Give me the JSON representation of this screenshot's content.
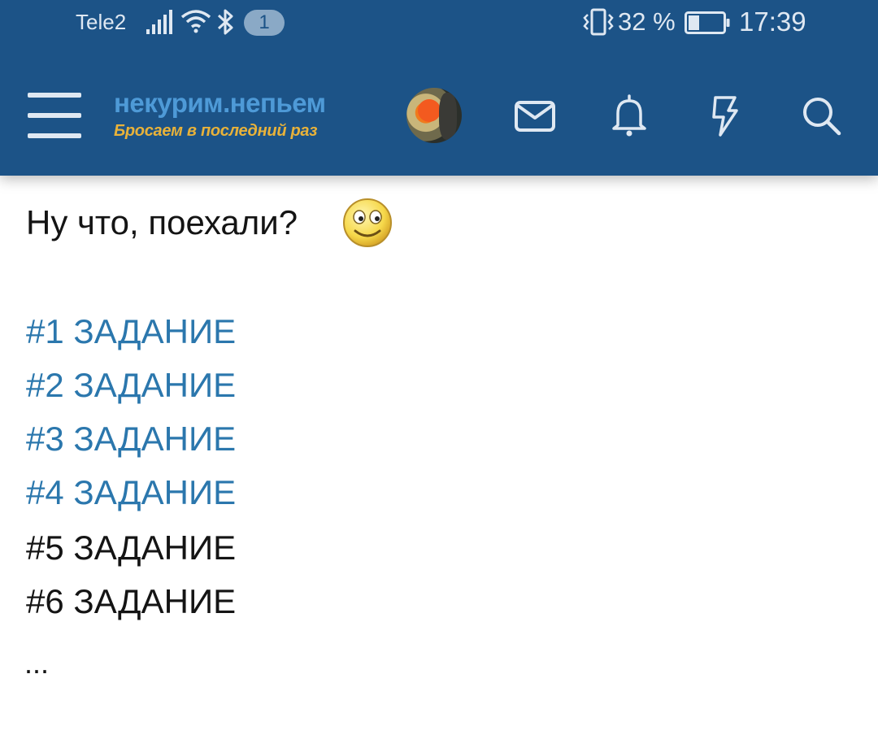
{
  "status_bar": {
    "carrier": "Tele2",
    "notification_count": "1",
    "battery_percent": "32 %",
    "battery_level": 0.32,
    "time": "17:39"
  },
  "app_bar": {
    "logo_title": "некурим.непьем",
    "logo_subtitle": "Бросаем в последний раз",
    "icons": [
      "menu-icon",
      "avatar",
      "envelope-icon",
      "bell-icon",
      "lightning-icon",
      "search-icon"
    ]
  },
  "content": {
    "intro_text": "Ну что, поехали?",
    "tasks": [
      {
        "label": "#1 ЗАДАНИЕ",
        "is_link": true
      },
      {
        "label": "#2 ЗАДАНИЕ",
        "is_link": true
      },
      {
        "label": "#3 ЗАДАНИЕ",
        "is_link": true
      },
      {
        "label": "#4 ЗАДАНИЕ",
        "is_link": true
      },
      {
        "label": "#5 ЗАДАНИЕ",
        "is_link": false
      },
      {
        "label": "#6 ЗАДАНИЕ",
        "is_link": false
      }
    ],
    "ellipsis": "..."
  },
  "colors": {
    "header_bg": "#1c5387",
    "link": "#2b77ad",
    "text": "#141414",
    "logo_blue": "#4e9ad7",
    "logo_yellow": "#e8b23a"
  }
}
